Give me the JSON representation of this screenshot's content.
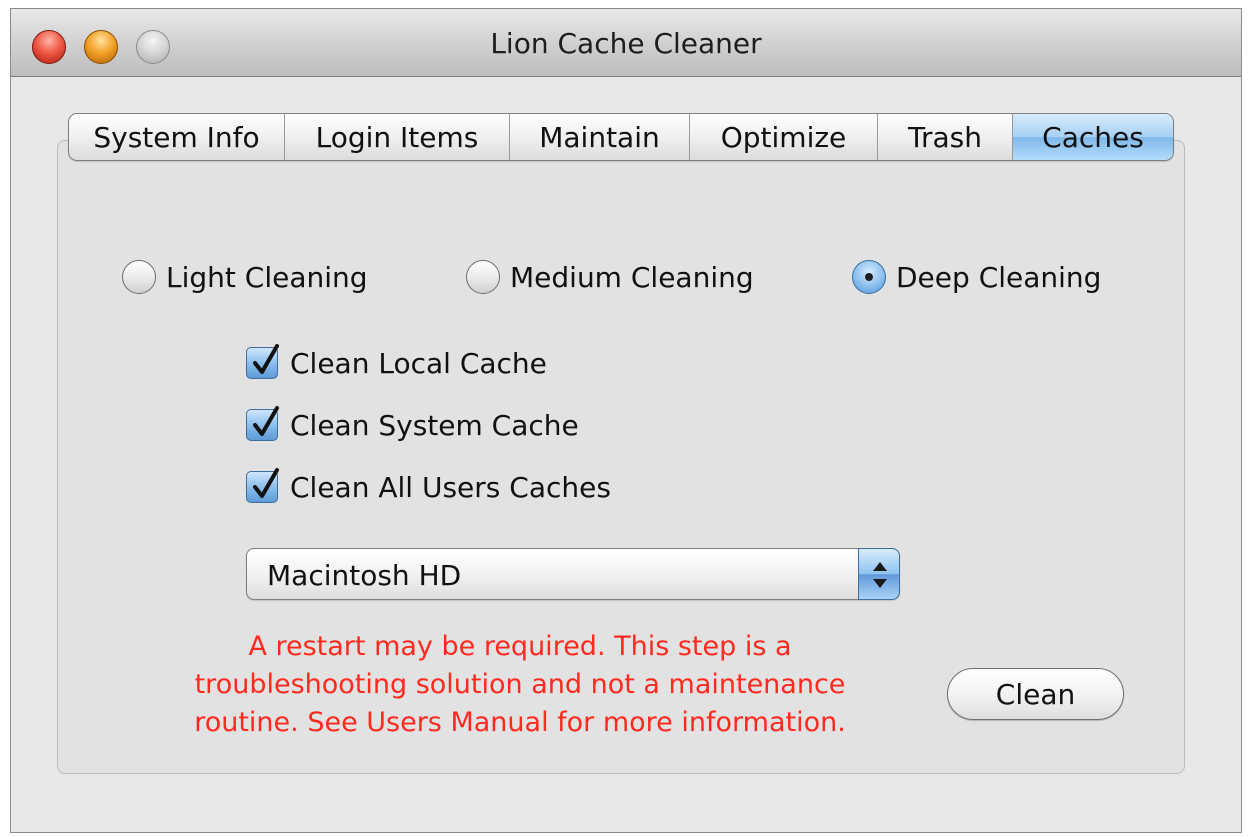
{
  "window": {
    "title": "Lion Cache Cleaner"
  },
  "tabs": [
    {
      "label": "System Info",
      "active": false
    },
    {
      "label": "Login Items",
      "active": false
    },
    {
      "label": "Maintain",
      "active": false
    },
    {
      "label": "Optimize",
      "active": false
    },
    {
      "label": "Trash",
      "active": false
    },
    {
      "label": "Caches",
      "active": true
    }
  ],
  "cleaning_levels": [
    {
      "label": "Light Cleaning",
      "selected": false
    },
    {
      "label": "Medium Cleaning",
      "selected": false
    },
    {
      "label": "Deep Cleaning",
      "selected": true
    }
  ],
  "options": [
    {
      "label": "Clean Local Cache",
      "checked": true
    },
    {
      "label": "Clean System Cache",
      "checked": true
    },
    {
      "label": "Clean All Users Caches",
      "checked": true
    }
  ],
  "volume_select": {
    "value": "Macintosh HD"
  },
  "warning": {
    "lines": [
      "A restart may be required.  This step is a",
      "troubleshooting solution and not a maintenance",
      "routine.  See Users Manual for more information."
    ],
    "color": "#ff2a1f"
  },
  "actions": {
    "clean_label": "Clean"
  }
}
